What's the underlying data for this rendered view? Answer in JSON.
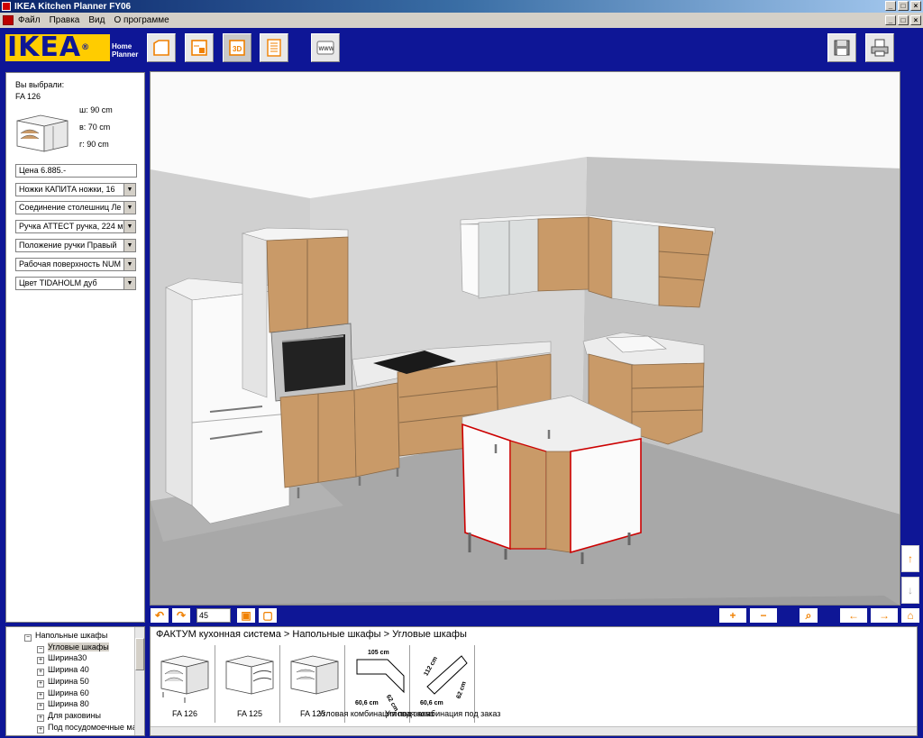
{
  "window": {
    "title": "IKEA Kitchen Planner FY06"
  },
  "menu": [
    "Файл",
    "Правка",
    "Вид",
    "О программе"
  ],
  "logo": {
    "brand": "IKEA",
    "reg": "®",
    "sub1": "Home",
    "sub2": "Planner"
  },
  "toolbar": {
    "tools": [
      "room-icon",
      "floor-plan-icon",
      "3d-view-icon",
      "list-icon",
      "web-icon"
    ],
    "www_label": "WWW",
    "view3d_label": "3D"
  },
  "selection": {
    "heading": "Вы выбрали:",
    "code": "FA 126",
    "width": "ш: 90 cm",
    "height": "в: 70 cm",
    "depth": "г: 90 cm",
    "price": "Цена  6.885.-",
    "options": [
      "Ножки   КАПИТА ножки, 16",
      "Соединение столешниц   Ле",
      "Ручка   ATTECT ручка, 224 м",
      "Положение ручки   Правый",
      "Рабочая поверхность   NUM",
      "Цвет   TIDAHOLM дуб"
    ]
  },
  "view_controls": {
    "angle": "45",
    "plus": "+",
    "minus": "−",
    "left": "←",
    "right": "→",
    "up": "↑",
    "down": "↓"
  },
  "tree": [
    {
      "box": "−",
      "label": "Напольные шкафы",
      "indent": 0
    },
    {
      "box": "−",
      "label": "Угловые шкафы",
      "indent": 1,
      "selected": true
    },
    {
      "box": "+",
      "label": "Ширина30",
      "indent": 1
    },
    {
      "box": "+",
      "label": "Ширина 40",
      "indent": 1
    },
    {
      "box": "+",
      "label": "Ширина 50",
      "indent": 1
    },
    {
      "box": "+",
      "label": "Ширина 60",
      "indent": 1
    },
    {
      "box": "+",
      "label": "Ширина 80",
      "indent": 1
    },
    {
      "box": "+",
      "label": "Для раковины",
      "indent": 1
    },
    {
      "box": "+",
      "label": "Под посудомоечные ма",
      "indent": 1
    }
  ],
  "catalog": {
    "breadcrumb": "ФАКТУМ кухонная система > Напольные шкафы > Угловые шкафы",
    "items": [
      {
        "label": "FA 126"
      },
      {
        "label": "FA 125"
      },
      {
        "label": "FA 125"
      },
      {
        "label": "Угловая комбинация под заказ",
        "dim_top": "105 cm",
        "dim_bottom": "60,6 cm",
        "dim_side": "62 cm"
      },
      {
        "label": "Угловая комбинация под заказ",
        "dim_top": "112 cm",
        "dim_bottom": "60,6 cm",
        "dim_side": "62 cm"
      }
    ]
  },
  "colors": {
    "brand_blue": "#0e1696",
    "brand_yellow": "#ffcc00",
    "accent_orange": "#f08000",
    "wood": "#c99a68"
  }
}
